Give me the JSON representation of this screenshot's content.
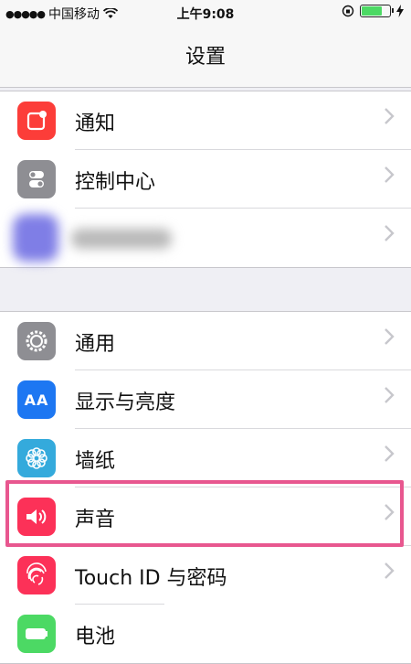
{
  "status_bar": {
    "signal_dots": "●●●●●",
    "carrier": "中国移动",
    "wifi_icon": "wifi-icon",
    "time": "上午9:08",
    "lock_icon": "rotation-lock-icon",
    "battery_level": 0.8,
    "charging_icon": "bolt-icon"
  },
  "nav": {
    "title": "设置"
  },
  "groups": [
    {
      "items": [
        {
          "label": "通知",
          "icon": "notifications-icon",
          "color": "#fc3d39"
        },
        {
          "label": "控制中心",
          "icon": "control-center-icon",
          "color": "#8e8e93"
        },
        {
          "label": "",
          "icon": "blurred-icon",
          "color": "#7f7ee6"
        }
      ]
    },
    {
      "items": [
        {
          "label": "通用",
          "icon": "gear-icon",
          "color": "#8e8e93"
        },
        {
          "label": "显示与亮度",
          "icon": "display-icon",
          "color": "#1d77f2"
        },
        {
          "label": "墙纸",
          "icon": "wallpaper-icon",
          "color": "#34aadc"
        },
        {
          "label": "声音",
          "icon": "speaker-icon",
          "color": "#fc3158"
        },
        {
          "label": "Touch ID 与密码",
          "icon": "fingerprint-icon",
          "color": "#fc3158"
        },
        {
          "label": "电池",
          "icon": "battery-icon",
          "color": "#4cd964"
        }
      ]
    }
  ],
  "icon_text": {
    "display": "AA"
  },
  "highlight_color": "#e8578f"
}
